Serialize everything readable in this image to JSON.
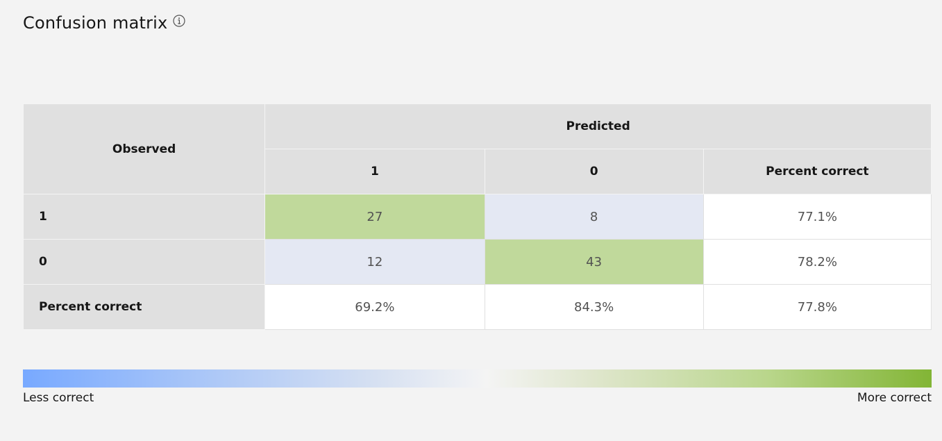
{
  "header": {
    "title": "Confusion matrix",
    "info_icon": "info-circle-icon"
  },
  "matrix": {
    "observed_label": "Observed",
    "predicted_label": "Predicted",
    "columns": [
      "1",
      "0",
      "Percent correct"
    ],
    "rows": [
      {
        "label": "1",
        "values": [
          "27",
          "8",
          "77.1%"
        ]
      },
      {
        "label": "0",
        "values": [
          "12",
          "43",
          "78.2%"
        ]
      },
      {
        "label": "Percent correct",
        "values": [
          "69.2%",
          "84.3%",
          "77.8%"
        ]
      }
    ]
  },
  "legend": {
    "low_label": "Less correct",
    "high_label": "More correct",
    "low_color": "#78a9ff",
    "high_color": "#82b535"
  }
}
